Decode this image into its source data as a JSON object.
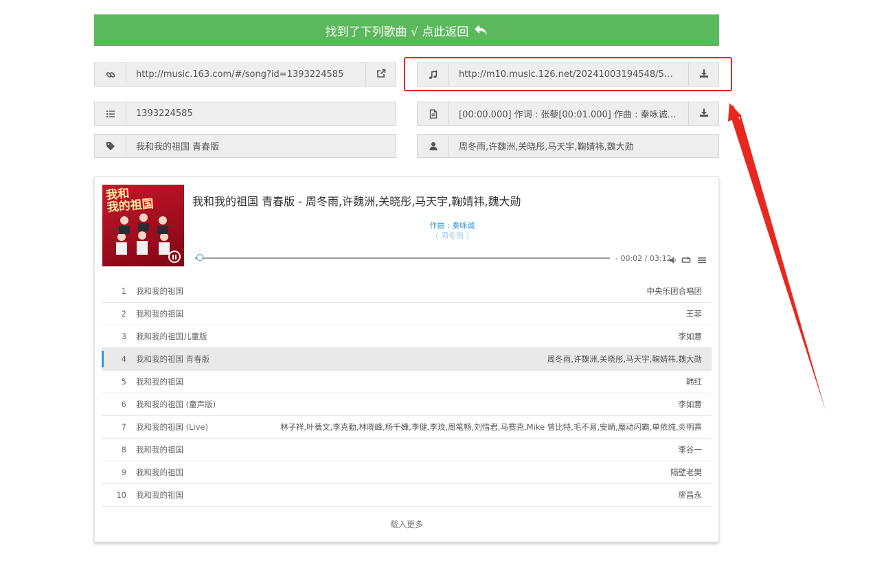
{
  "banner": {
    "text": "找到了下列歌曲 √ 点此返回",
    "color": "#5cb85c"
  },
  "fields": {
    "song_url": {
      "value": "http://music.163.com/#/song?id=1393224585",
      "icon": "link-icon",
      "action_icon": "external-link-icon"
    },
    "audio_url": {
      "value": "http://m10.music.126.net/20241003194548/50c54…",
      "icon": "music-note-icon",
      "action_icon": "download-icon"
    },
    "song_id": {
      "value": "1393224585",
      "icon": "list-icon"
    },
    "lyrics": {
      "value": "[00:00.000] 作词 : 张藜[00:01.000] 作曲 : 秦咏诚[00…",
      "icon": "document-icon",
      "action_icon": "download-icon"
    },
    "title": {
      "value": "我和我的祖国 青春版",
      "icon": "tag-icon"
    },
    "artist": {
      "value": "周冬雨,许魏洲,关晓彤,马天宇,鞠婧祎,魏大勋",
      "icon": "user-icon"
    }
  },
  "annotation": {
    "color": "#e8281e"
  },
  "player": {
    "cover_text": "我和\n我的祖国",
    "now_playing": "我和我的祖国 青春版 - 周冬雨,许魏洲,关晓彤,马天宇,鞠婧祎,魏大勋",
    "lyric_current": "作曲 : 秦咏诚",
    "lyric_next": "（ 周冬雨 ）",
    "time": "- 00:02 / 03:12",
    "progress": 0.01,
    "accent": "#3196d3"
  },
  "playlist": [
    {
      "index": "1",
      "name": "我和我的祖国",
      "artist": "中央乐团合唱团"
    },
    {
      "index": "2",
      "name": "我和我的祖国",
      "artist": "王菲"
    },
    {
      "index": "3",
      "name": "我和我的祖国儿童版",
      "artist": "李如意"
    },
    {
      "index": "4",
      "name": "我和我的祖国 青春版",
      "artist": "周冬雨,许魏洲,关晓彤,马天宇,鞠婧祎,魏大勋",
      "active": true
    },
    {
      "index": "5",
      "name": "我和我的祖国",
      "artist": "韩红"
    },
    {
      "index": "6",
      "name": "我和我的祖国 (童声版)",
      "artist": "李如意"
    },
    {
      "index": "7",
      "name": "我和我的祖国 (Live)",
      "artist": "林子祥,叶蒨文,李克勤,林晓峰,杨千嬅,李健,李玟,周笔畅,刘惜君,马赛克,Mike 曾比特,毛不易,安崎,魔动闪霸,单依纯,炎明熹"
    },
    {
      "index": "8",
      "name": "我和我的祖国",
      "artist": "李谷一"
    },
    {
      "index": "9",
      "name": "我和我的祖国",
      "artist": "隔壁老樊"
    },
    {
      "index": "10",
      "name": "我和我的祖国",
      "artist": "廖昌永"
    }
  ],
  "load_more": "载入更多"
}
